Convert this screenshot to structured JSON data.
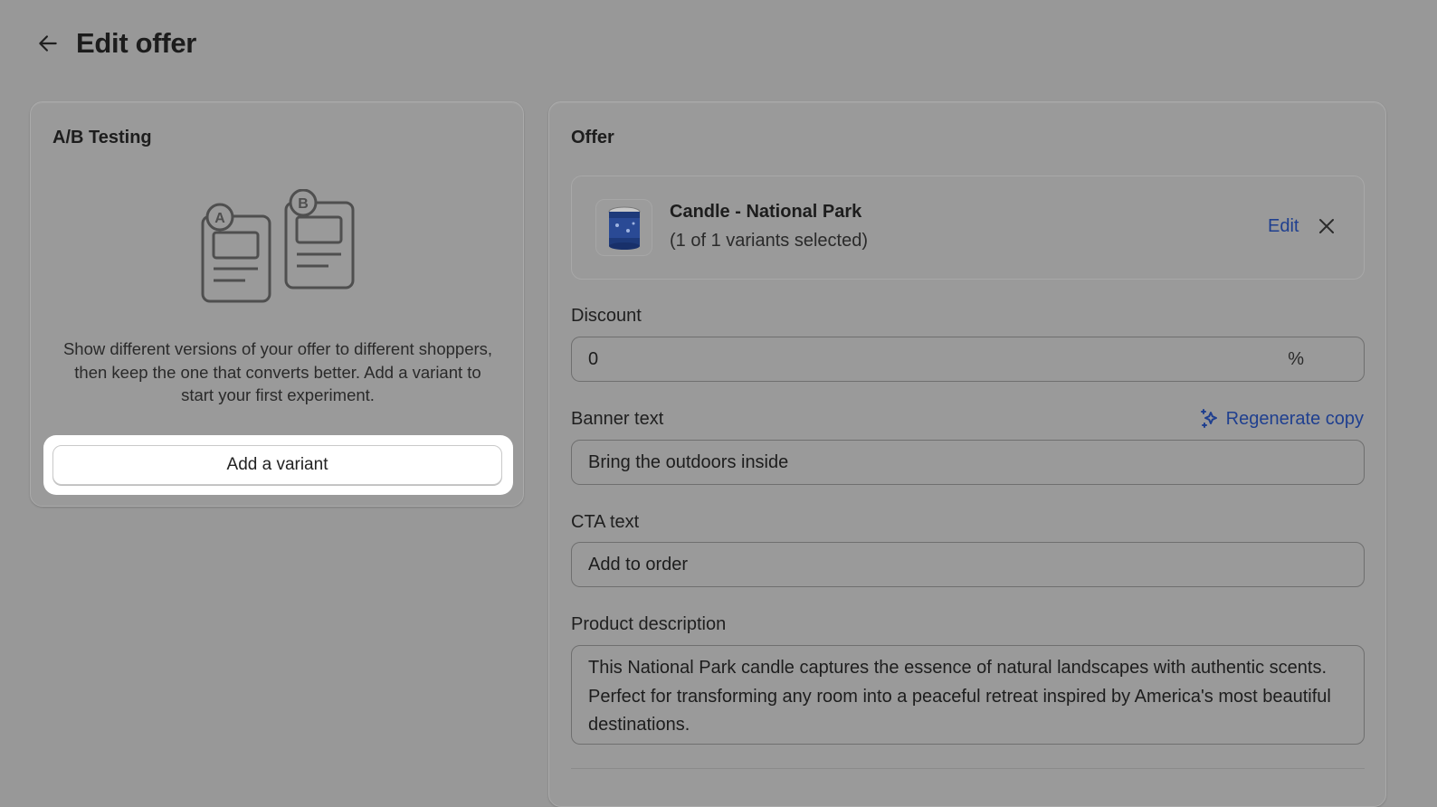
{
  "header": {
    "title": "Edit offer"
  },
  "ab_testing": {
    "title": "A/B Testing",
    "illustration": {
      "label_a": "A",
      "label_b": "B"
    },
    "description": "Show different versions of your offer to different shoppers, then keep the one that converts better. Add a variant to start your first experiment.",
    "add_variant_label": "Add a variant"
  },
  "offer": {
    "title": "Offer",
    "product": {
      "name": "Candle - National Park",
      "variants_text": "(1 of 1 variants selected)",
      "edit_label": "Edit"
    },
    "discount": {
      "label": "Discount",
      "value": "0",
      "suffix": "%"
    },
    "banner_text": {
      "label": "Banner text",
      "value": "Bring the outdoors inside",
      "regenerate_label": "Regenerate copy"
    },
    "cta_text": {
      "label": "CTA text",
      "value": "Add to order"
    },
    "product_description": {
      "label": "Product description",
      "value": "This National Park candle captures the essence of natural landscapes with authentic scents. Perfect for transforming any room into a peaceful retreat inspired by America's most beautiful destinations."
    }
  },
  "colors": {
    "accent_link": "#1f3f8f",
    "overlay_bg": "#989898"
  },
  "icons": [
    "arrow-left-icon",
    "close-icon",
    "sparkle-icon",
    "candle-jar-icon"
  ]
}
